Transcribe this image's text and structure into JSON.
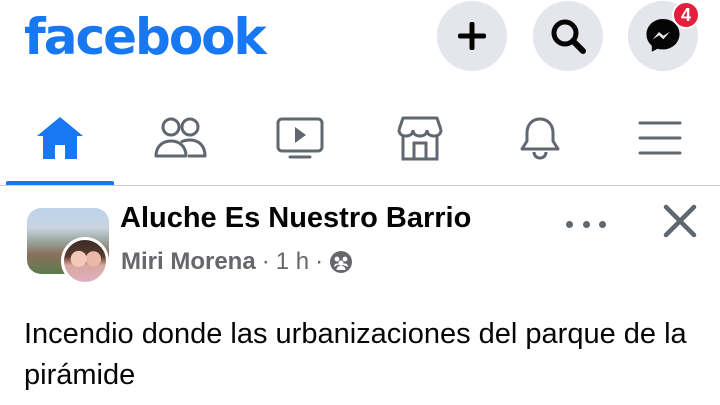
{
  "header": {
    "logo": "facebook",
    "messenger_badge": "4"
  },
  "tabs": [
    {
      "name": "home",
      "active": true
    },
    {
      "name": "friends",
      "active": false
    },
    {
      "name": "watch",
      "active": false
    },
    {
      "name": "marketplace",
      "active": false
    },
    {
      "name": "notifications",
      "active": false
    },
    {
      "name": "menu",
      "active": false
    }
  ],
  "post": {
    "group_name": "Aluche Es Nuestro Barrio",
    "author": "Miri Morena",
    "separator": "·",
    "time": "1 h",
    "privacy_icon": "group-privacy-icon",
    "text": "Incendio donde las urbanizaciones del parque de la pirámide"
  },
  "colors": {
    "brand": "#1877f2",
    "badge": "#e41e3f",
    "icon_gray": "#606770",
    "meta_gray": "#65676b"
  }
}
